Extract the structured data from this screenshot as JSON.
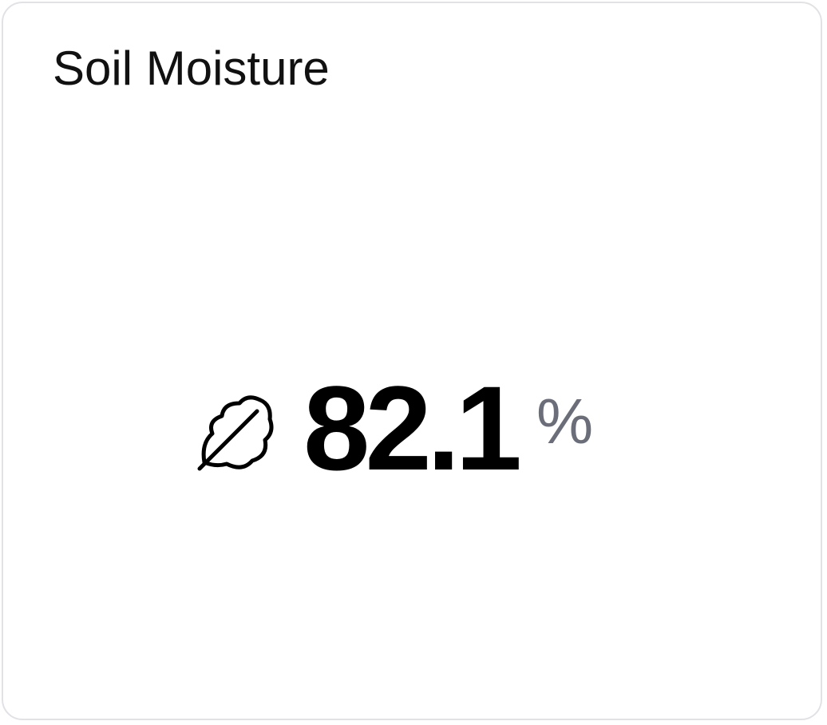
{
  "card": {
    "title": "Soil Moisture",
    "icon": "leaf-icon",
    "value": "82.1",
    "unit": "%"
  },
  "colors": {
    "border": "#e2e2e6",
    "value": "#000000",
    "unit": "#6b6e78"
  }
}
